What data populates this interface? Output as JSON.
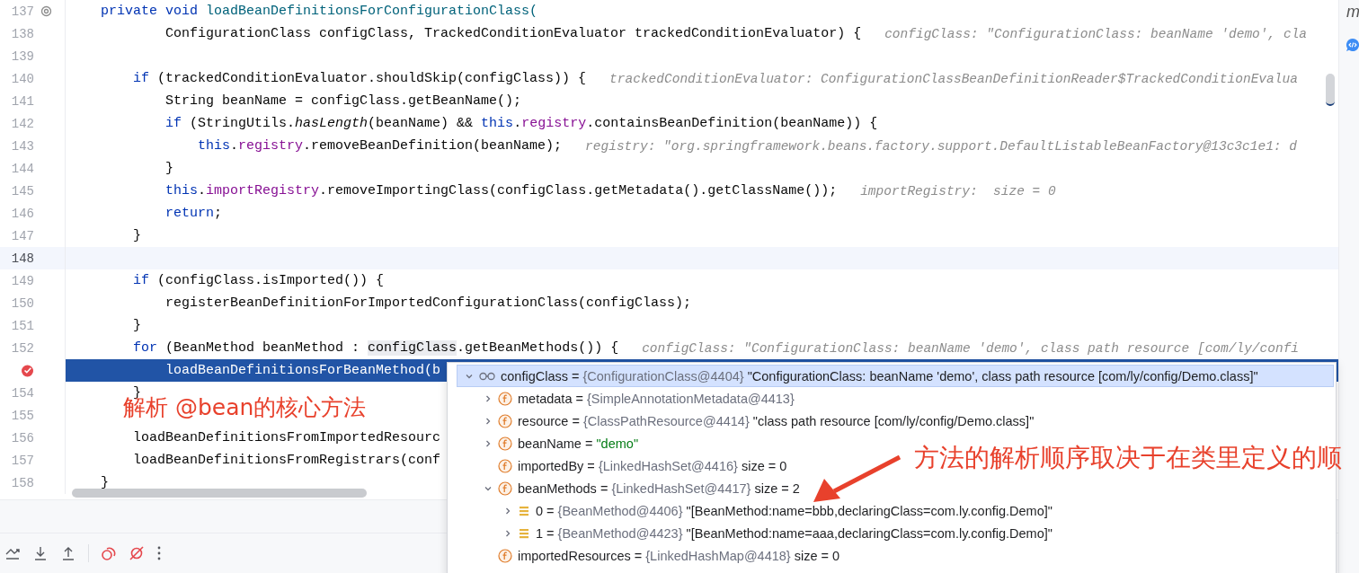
{
  "editor": {
    "lines": [
      {
        "number": "137",
        "kind": "override",
        "segments": [
          {
            "text": "    private void ",
            "kind": "kw"
          },
          {
            "text": "loadBeanDefinitionsForConfigurationClass(",
            "kind": "decl"
          }
        ]
      },
      {
        "number": "138",
        "kind": "code",
        "segments": [
          {
            "text": "            ConfigurationClass configClass, TrackedConditionEvaluator trackedConditionEvaluator) {",
            "kind": "plain"
          }
        ],
        "hint": "configClass: \"ConfigurationClass: beanName 'demo', cla"
      },
      {
        "number": "139",
        "kind": "code"
      },
      {
        "number": "140",
        "kind": "code",
        "segments": [
          {
            "text": "        if",
            "kind": "kw"
          },
          {
            "text": " (trackedConditionEvaluator.shouldSkip(configClass)) {",
            "kind": "plain"
          }
        ],
        "hint": "trackedConditionEvaluator: ConfigurationClassBeanDefinitionReader$TrackedConditionEvalua"
      },
      {
        "number": "141",
        "kind": "code",
        "segments": [
          {
            "text": "            String beanName = configClass.getBeanName();",
            "kind": "plain"
          }
        ]
      },
      {
        "number": "142",
        "kind": "code",
        "segments": [
          {
            "text": "            if",
            "kind": "kw"
          },
          {
            "text": " (StringUtils.",
            "kind": "plain"
          },
          {
            "text": "hasLength",
            "kind": "static"
          },
          {
            "text": "(beanName) && ",
            "kind": "plain"
          },
          {
            "text": "this",
            "kind": "kw"
          },
          {
            "text": ".",
            "kind": "plain"
          },
          {
            "text": "registry",
            "kind": "field"
          },
          {
            "text": ".containsBeanDefinition(beanName)) {",
            "kind": "plain"
          }
        ]
      },
      {
        "number": "143",
        "kind": "code",
        "segments": [
          {
            "text": "                this",
            "kind": "kw"
          },
          {
            "text": ".",
            "kind": "plain"
          },
          {
            "text": "registry",
            "kind": "field"
          },
          {
            "text": ".removeBeanDefinition(beanName);",
            "kind": "plain"
          }
        ],
        "hint": "registry: \"org.springframework.beans.factory.support.DefaultListableBeanFactory@13c3c1e1: d"
      },
      {
        "number": "144",
        "kind": "code",
        "segments": [
          {
            "text": "            }",
            "kind": "plain"
          }
        ]
      },
      {
        "number": "145",
        "kind": "code",
        "segments": [
          {
            "text": "            this",
            "kind": "kw"
          },
          {
            "text": ".",
            "kind": "plain"
          },
          {
            "text": "importRegistry",
            "kind": "field"
          },
          {
            "text": ".removeImportingClass(configClass.getMetadata().getClassName());",
            "kind": "plain"
          }
        ],
        "hint": "importRegistry:  size = 0"
      },
      {
        "number": "146",
        "kind": "code",
        "segments": [
          {
            "text": "            return",
            "kind": "kw"
          },
          {
            "text": ";",
            "kind": "plain"
          }
        ]
      },
      {
        "number": "147",
        "kind": "code",
        "segments": [
          {
            "text": "        }",
            "kind": "plain"
          }
        ]
      },
      {
        "number": "148",
        "kind": "caret"
      },
      {
        "number": "149",
        "kind": "code",
        "segments": [
          {
            "text": "        if",
            "kind": "kw"
          },
          {
            "text": " (configClass.isImported()) {",
            "kind": "plain"
          }
        ]
      },
      {
        "number": "150",
        "kind": "code",
        "segments": [
          {
            "text": "            registerBeanDefinitionForImportedConfigurationClass(configClass);",
            "kind": "plain"
          }
        ]
      },
      {
        "number": "151",
        "kind": "code",
        "segments": [
          {
            "text": "        }",
            "kind": "plain"
          }
        ]
      },
      {
        "number": "152",
        "kind": "code",
        "segments": [
          {
            "text": "        for",
            "kind": "kw"
          },
          {
            "text": " (BeanMethod beanMethod : ",
            "kind": "plain"
          },
          {
            "text": "configClass",
            "kind": "hover"
          },
          {
            "text": ".getBeanMethods()) {",
            "kind": "plain"
          }
        ],
        "hint": "configClass: \"ConfigurationClass: beanName 'demo', class path resource [com/ly/confi"
      },
      {
        "kind": "execution",
        "segments": [
          {
            "text": "            loadBeanDefinitionsForBeanMethod(b",
            "kind": "plain"
          }
        ]
      },
      {
        "number": "154",
        "kind": "code",
        "segments": [
          {
            "text": "        }",
            "kind": "plain"
          }
        ]
      },
      {
        "number": "155",
        "kind": "code"
      },
      {
        "number": "156",
        "kind": "code",
        "segments": [
          {
            "text": "        loadBeanDefinitionsFromImportedResourc",
            "kind": "plain"
          }
        ]
      },
      {
        "number": "157",
        "kind": "code",
        "segments": [
          {
            "text": "        loadBeanDefinitionsFromRegistrars(conf",
            "kind": "plain"
          }
        ]
      },
      {
        "number": "158",
        "kind": "code",
        "segments": [
          {
            "text": "    }",
            "kind": "plain"
          }
        ]
      }
    ]
  },
  "side_strip": {
    "label": "m"
  },
  "debug_popup": {
    "variables": [
      {
        "kind": "watch",
        "name": "configClass",
        "operator": "=",
        "type": "{ConfigurationClass@4404}",
        "value": "\"ConfigurationClass: beanName 'demo', class path resource [com/ly/config/Demo.class]\"",
        "expandable": true,
        "expanded": true,
        "selected": true,
        "literal": false,
        "children": [
          {
            "kind": "field",
            "name": "metadata",
            "operator": "=",
            "type": "{SimpleAnnotationMetadata@4413}",
            "expandable": true,
            "expanded": false,
            "selected": false
          },
          {
            "kind": "field",
            "name": "resource",
            "operator": "=",
            "type": "{ClassPathResource@4414}",
            "value": "\"class path resource [com/ly/config/Demo.class]\"",
            "expandable": true,
            "expanded": false,
            "selected": false,
            "literal": false
          },
          {
            "kind": "field",
            "name": "beanName",
            "operator": "=",
            "value": "\"demo\"",
            "expandable": true,
            "expanded": false,
            "selected": false,
            "literal": true
          },
          {
            "kind": "field",
            "name": "importedBy",
            "operator": "=",
            "type": "{LinkedHashSet@4416}",
            "value": "size = 0",
            "expandable": false,
            "selected": false,
            "literal": false
          },
          {
            "kind": "field",
            "name": "beanMethods",
            "operator": "=",
            "type": "{LinkedHashSet@4417}",
            "value": "size = 2",
            "expandable": true,
            "expanded": true,
            "selected": false,
            "literal": false,
            "children": [
              {
                "kind": "element",
                "name": "0",
                "operator": "=",
                "type": "{BeanMethod@4406}",
                "value": "\"[BeanMethod:name=bbb,declaringClass=com.ly.config.Demo]\"",
                "expandable": true,
                "expanded": false,
                "selected": false,
                "literal": false
              },
              {
                "kind": "element",
                "name": "1",
                "operator": "=",
                "type": "{BeanMethod@4423}",
                "value": "\"[BeanMethod:name=aaa,declaringClass=com.ly.config.Demo]\"",
                "expandable": true,
                "expanded": false,
                "selected": false,
                "literal": false
              }
            ]
          },
          {
            "kind": "field",
            "name": "importedResources",
            "operator": "=",
            "type": "{LinkedHashMap@4418}",
            "value": "size = 0",
            "expandable": false,
            "selected": false,
            "literal": false
          }
        ]
      }
    ]
  },
  "annotations": [
    {
      "text": "解析 @bean的核心方法",
      "kind": "note_left"
    },
    {
      "text": "方法的解析顺序取决于在类里定义的顺",
      "kind": "note_right"
    }
  ],
  "toolbar": {
    "buttons": [
      {
        "kind": "step_over"
      },
      {
        "kind": "step_into"
      },
      {
        "kind": "step_out"
      },
      {
        "kind": "separator"
      },
      {
        "kind": "view_breakpoints"
      },
      {
        "kind": "mute_breakpoints"
      },
      {
        "kind": "more"
      }
    ]
  }
}
